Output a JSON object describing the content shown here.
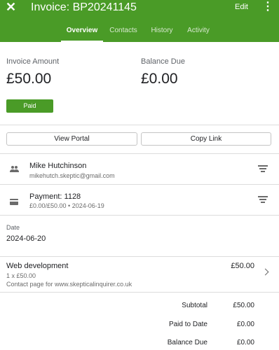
{
  "header": {
    "close_icon": "close-icon",
    "title": "Invoice: BP20241145",
    "edit_label": "Edit",
    "more_icon": "more-vert-icon",
    "background_color": "#4a9b27"
  },
  "tabs": [
    {
      "label": "Overview",
      "active": true
    },
    {
      "label": "Contacts",
      "active": false
    },
    {
      "label": "History",
      "active": false
    },
    {
      "label": "Activity",
      "active": false
    }
  ],
  "summary": {
    "invoice_amount_label": "Invoice Amount",
    "invoice_amount": "£50.00",
    "balance_due_label": "Balance Due",
    "balance_due": "£0.00",
    "status_label": "Paid"
  },
  "actions": {
    "view_portal": "View Portal",
    "copy_link": "Copy Link"
  },
  "contact": {
    "icon": "people-icon",
    "name": "Mike Hutchinson",
    "email": "mikehutch.skeptic@gmail.com"
  },
  "payment": {
    "icon": "credit-card-icon",
    "title": "Payment: 1128",
    "detail": "£0.00/£50.00 • 2024-06-19"
  },
  "date": {
    "label": "Date",
    "value": "2024-06-20"
  },
  "line_item": {
    "name": "Web development",
    "amount": "£50.00",
    "quantity": "1 x £50.00",
    "description": "Contact page for www.skepticalinquirer.co.uk"
  },
  "totals": [
    {
      "label": "Subtotal",
      "value": "£50.00"
    },
    {
      "label": "Paid to Date",
      "value": "£0.00"
    },
    {
      "label": "Balance Due",
      "value": "£0.00"
    }
  ]
}
